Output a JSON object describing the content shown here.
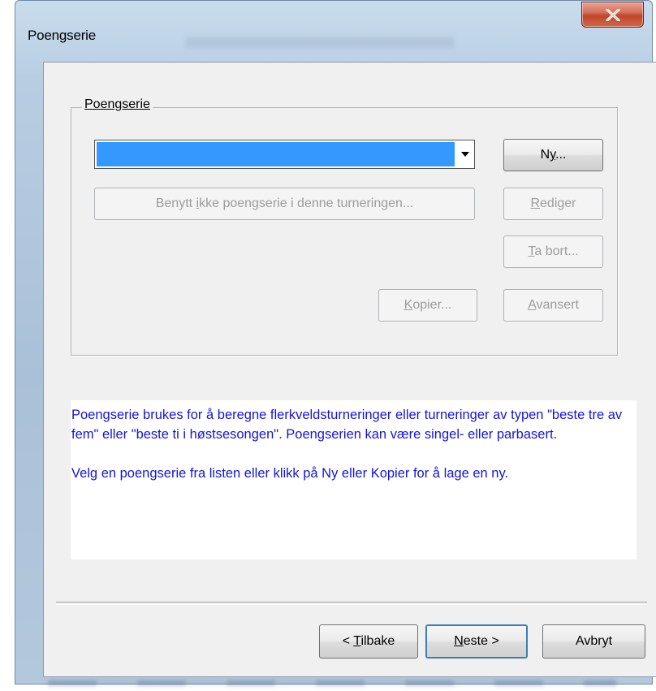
{
  "window": {
    "title": "Poengserie"
  },
  "group": {
    "label": "Poengserie"
  },
  "combo": {
    "selected_value": ""
  },
  "buttons": {
    "ny": {
      "pre": "N",
      "mn": "y",
      "post": "..."
    },
    "benytt": {
      "pre": "Benytt ",
      "mn": "i",
      "post": "kke poengserie i denne turneringen..."
    },
    "rediger": {
      "pre": "",
      "mn": "R",
      "post": "ediger"
    },
    "ta_bort": {
      "pre": "",
      "mn": "T",
      "post": "a bort..."
    },
    "kopier": {
      "pre": "",
      "mn": "K",
      "post": "opier..."
    },
    "avansert": {
      "pre": "",
      "mn": "A",
      "post": "vansert"
    },
    "tilbake": {
      "pre": "< ",
      "mn": "T",
      "post": "ilbake"
    },
    "neste": {
      "pre": "",
      "mn": "N",
      "post": "este >"
    },
    "avbryt": {
      "label": "Avbryt"
    }
  },
  "info": {
    "paragraph1": "Poengserie brukes for å beregne flerkveldsturneringer eller turneringer av typen \"beste tre av fem\" eller \"beste ti i høstsesongen\". Poengserien kan være singel- eller parbasert.",
    "paragraph2": "Velg en poengserie fra listen eller klikk på Ny eller Kopier for å lage en ny."
  },
  "colors": {
    "selection": "#3399ff",
    "info_text": "#1515d8",
    "close_button": "#c7472d"
  },
  "icons": {
    "close": "close-icon",
    "dropdown": "chevron-down-icon"
  }
}
